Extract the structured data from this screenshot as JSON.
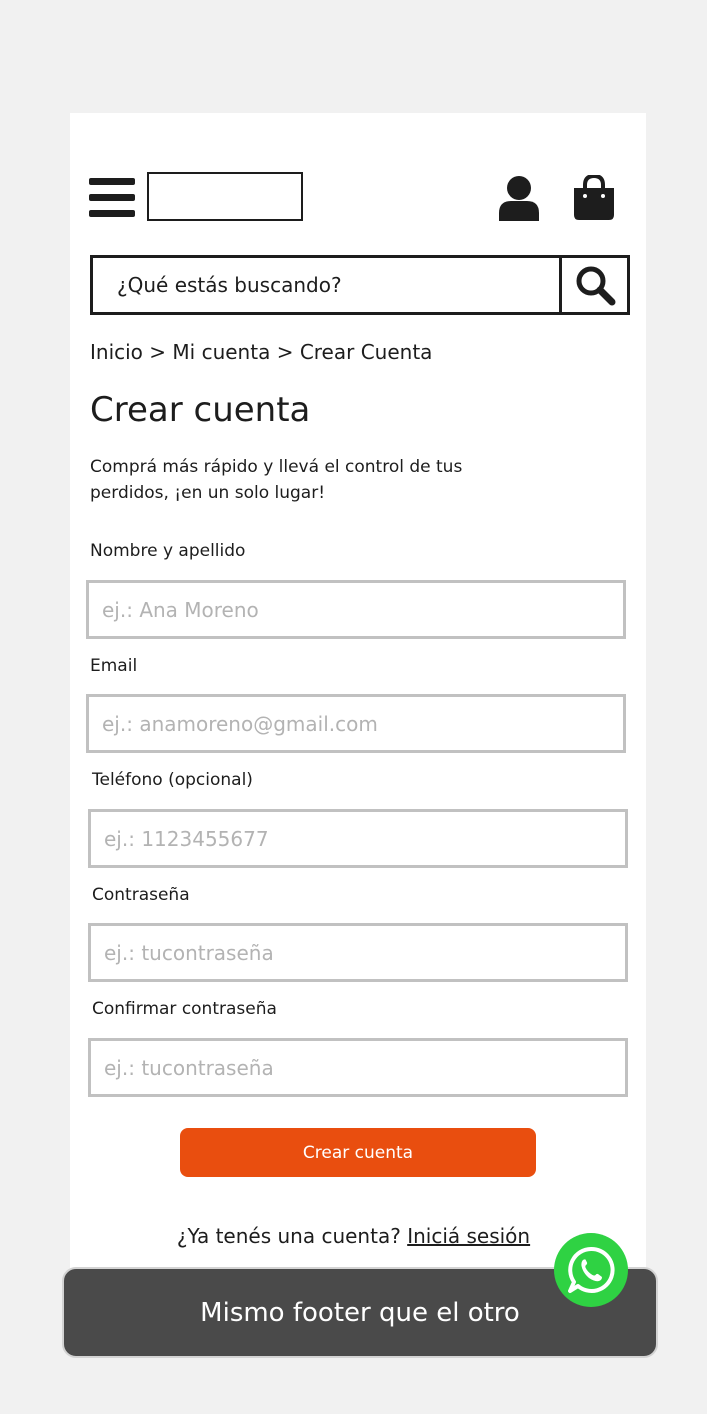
{
  "header": {
    "menu_icon": "hamburger-menu-icon",
    "account_icon": "user-icon",
    "cart_icon": "shopping-bag-icon"
  },
  "search": {
    "placeholder": "¿Qué estás buscando?",
    "button_icon": "search-icon"
  },
  "breadcrumb": {
    "items": [
      "Inicio",
      "Mi cuenta",
      "Crear Cuenta"
    ],
    "separator": ">"
  },
  "page": {
    "title": "Crear cuenta",
    "subtitle": "Comprá más rápido y llevá el control de tus perdidos, ¡en un solo lugar!"
  },
  "form": {
    "fields": [
      {
        "label": "Nombre y apellido",
        "placeholder": "ej.: Ana Moreno",
        "value": ""
      },
      {
        "label": "Email",
        "placeholder": "ej.: anamoreno@gmail.com",
        "value": ""
      },
      {
        "label": "Teléfono (opcional)",
        "placeholder": "ej.: 1123455677",
        "value": ""
      },
      {
        "label": "Contraseña",
        "placeholder": "ej.: tucontraseña",
        "value": ""
      },
      {
        "label": "Confirmar contraseña",
        "placeholder": "ej.: tucontraseña",
        "value": ""
      }
    ],
    "submit_label": "Crear cuenta"
  },
  "login": {
    "prompt": "¿Ya tenés una cuenta?",
    "link_label": "Iniciá sesión"
  },
  "footer": {
    "text": "Mismo footer que el otro"
  },
  "whatsapp": {
    "icon": "whatsapp-icon"
  },
  "colors": {
    "accent": "#e94e0f",
    "whatsapp": "#2fd243",
    "footer_bg": "#4a4a4a",
    "background": "#f1f1f1"
  }
}
